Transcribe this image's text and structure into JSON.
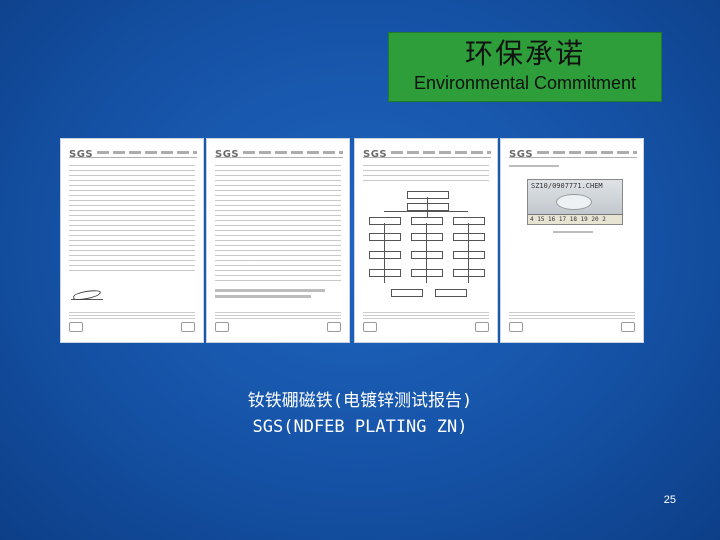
{
  "title": {
    "cn": "环保承诺",
    "en": "Environmental Commitment"
  },
  "documents": [
    {
      "logo": "SGS"
    },
    {
      "logo": "SGS"
    },
    {
      "logo": "SGS"
    },
    {
      "logo": "SGS",
      "photo_code": "SZ10/0907771.CHEM",
      "ruler": "4 15 16 17 18 19 20 2"
    }
  ],
  "caption": {
    "line1": "钕铁硼磁铁(电镀锌测试报告)",
    "line2": "SGS(NDFEB PLATING ZN)"
  },
  "page_number": "25"
}
